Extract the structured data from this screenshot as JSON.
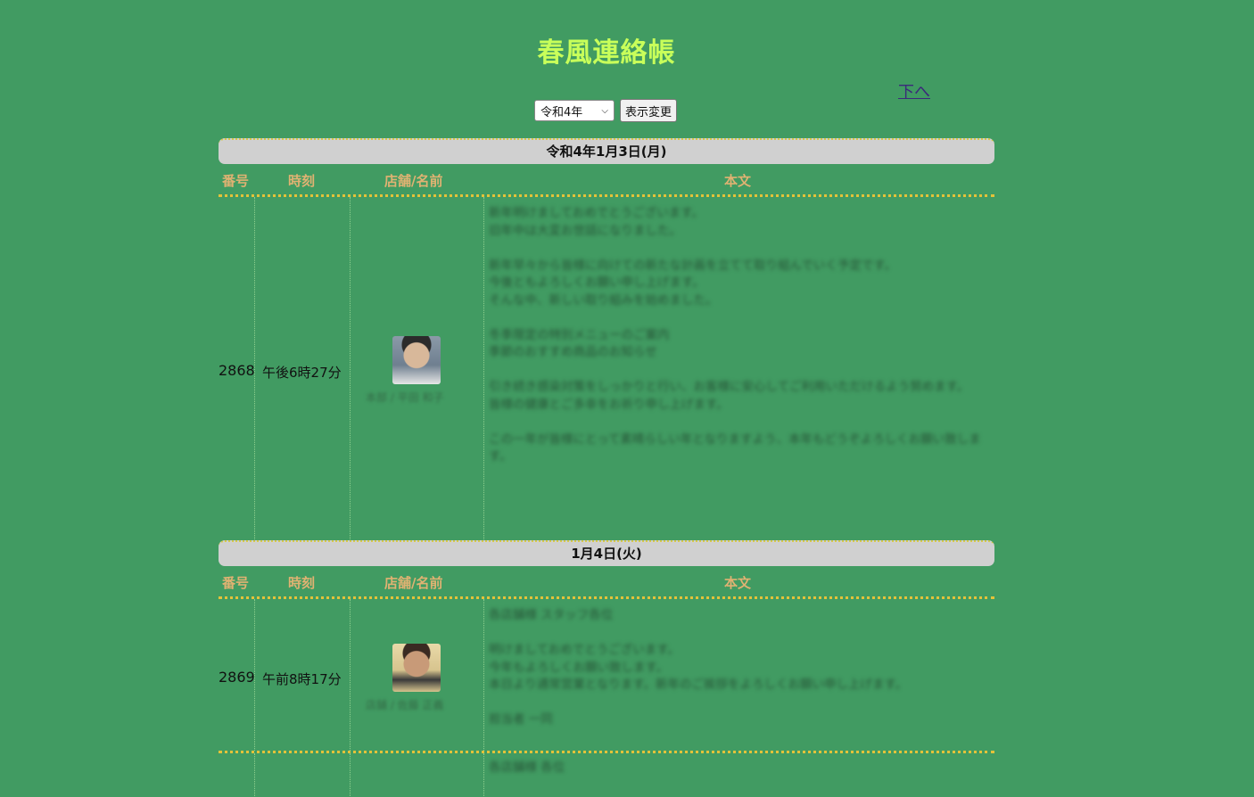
{
  "site": {
    "title": "春風連絡帳",
    "down_link": "下へ"
  },
  "controls": {
    "year_selected": "令和4年",
    "submit_label": "表示変更"
  },
  "columns": {
    "number": "番号",
    "time": "時刻",
    "shop": "店舗/名前",
    "body": "本文"
  },
  "days": [
    {
      "date": "令和4年1月3日(月)",
      "posts": [
        {
          "number": "2868",
          "time": "午後6時27分",
          "avatar": "person-photo",
          "shop_name": "本部 / 平田 和子",
          "body": "新年明けましておめでとうございます。\n旧年中は大変お世話になりました。\n\n新年早々から皆様に向けての新たな計画を立てて取り組んでいく予定です。\n今後ともよろしくお願い申し上げます。\nそんな中、新しい取り組みを始めました。\n\n冬季限定の特別メニューのご案内\n季節のおすすめ商品のお知らせ\n\n引き続き感染対策をしっかりと行い、お客様に安心してご利用いただけるよう努めます。\n皆様の健康とご多幸をお祈り申し上げます。\n\nこの一年が皆様にとって素晴らしい年となりますよう、本年もどうぞよろしくお願い致します。"
        }
      ]
    },
    {
      "date": "1月4日(火)",
      "posts": [
        {
          "number": "2869",
          "time": "午前8時17分",
          "avatar": "person-photo",
          "shop_name": "店舗 / 佐藤 正義",
          "body": "各店舗様 スタッフ各位\n\n明けましておめでとうございます。\n今年もよろしくお願い致します。\n本日より通常営業となります。新年のご挨拶をよろしくお願い申し上げます。\n\n担当者 一同"
        }
      ]
    }
  ],
  "partial_row": {
    "body": "各店舗様 各位"
  }
}
